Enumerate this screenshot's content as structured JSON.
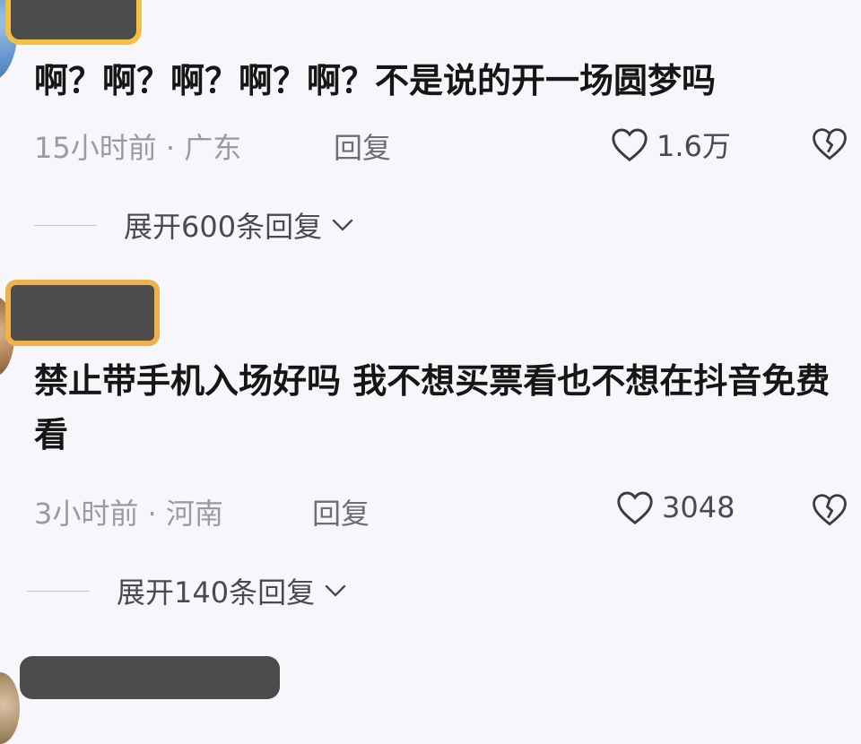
{
  "comments": [
    {
      "text": "啊？啊？啊？啊？啊？不是说的开一场圆梦吗",
      "time_location": "15小时前 · 广东",
      "reply_label": "回复",
      "likes": "1.6万",
      "expand_label": "展开600条回复"
    },
    {
      "text": "禁止带手机入场好吗 我不想买票看也不想在抖音免费看",
      "time_location": "3小时前 · 河南",
      "reply_label": "回复",
      "likes": "3048",
      "expand_label": "展开140条回复"
    }
  ],
  "icons": {
    "like": "heart-outline-icon",
    "dislike": "broken-heart-icon",
    "expand": "chevron-down-icon"
  },
  "colors": {
    "text": "#161616",
    "meta": "#9a9aa0",
    "background": "#f7f7fb"
  }
}
